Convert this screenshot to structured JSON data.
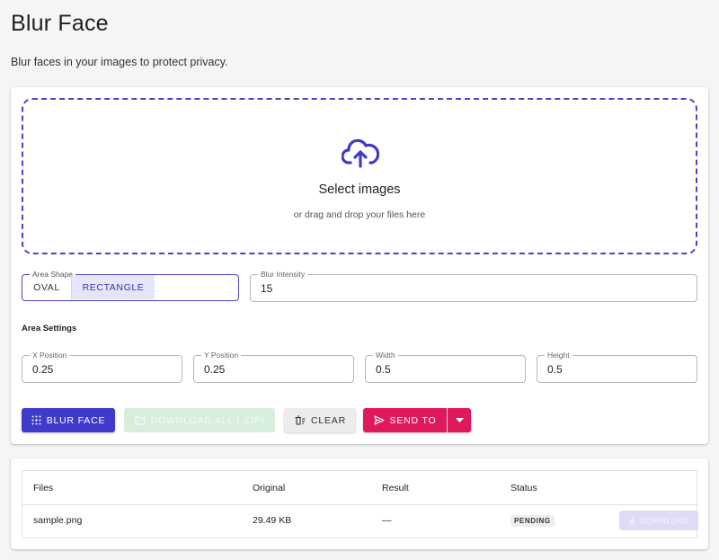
{
  "page": {
    "title": "Blur Face",
    "subtitle": "Blur faces in your images to protect privacy."
  },
  "dropzone": {
    "title": "Select images",
    "hint": "or drag and drop your files here",
    "icon": "cloud-upload-icon"
  },
  "area_shape": {
    "label": "Area Shape",
    "options": [
      "OVAL",
      "RECTANGLE"
    ],
    "selected": "RECTANGLE"
  },
  "blur_intensity": {
    "label": "Blur Intensity",
    "value": "15"
  },
  "area_settings": {
    "title": "Area Settings",
    "x": {
      "label": "X Position",
      "value": "0.25"
    },
    "y": {
      "label": "Y Position",
      "value": "0.25"
    },
    "width": {
      "label": "Width",
      "value": "0.5"
    },
    "height": {
      "label": "Height",
      "value": "0.5"
    }
  },
  "actions": {
    "blur_face": "BLUR FACE",
    "download_all": "DOWNLOAD ALL (.ZIP)",
    "clear": "CLEAR",
    "send_to": "SEND TO"
  },
  "files_table": {
    "columns": [
      "Files",
      "Original",
      "Result",
      "Status"
    ],
    "rows": [
      {
        "file": "sample.png",
        "original": "29.49 KB",
        "result": "—",
        "status": "PENDING",
        "action": "DOWNLOAD"
      }
    ]
  },
  "colors": {
    "primary": "#3f3acb",
    "accent": "#e0195e",
    "dropzone_border": "#4a45c8",
    "selected_toggle_bg": "#e6e5fa"
  }
}
